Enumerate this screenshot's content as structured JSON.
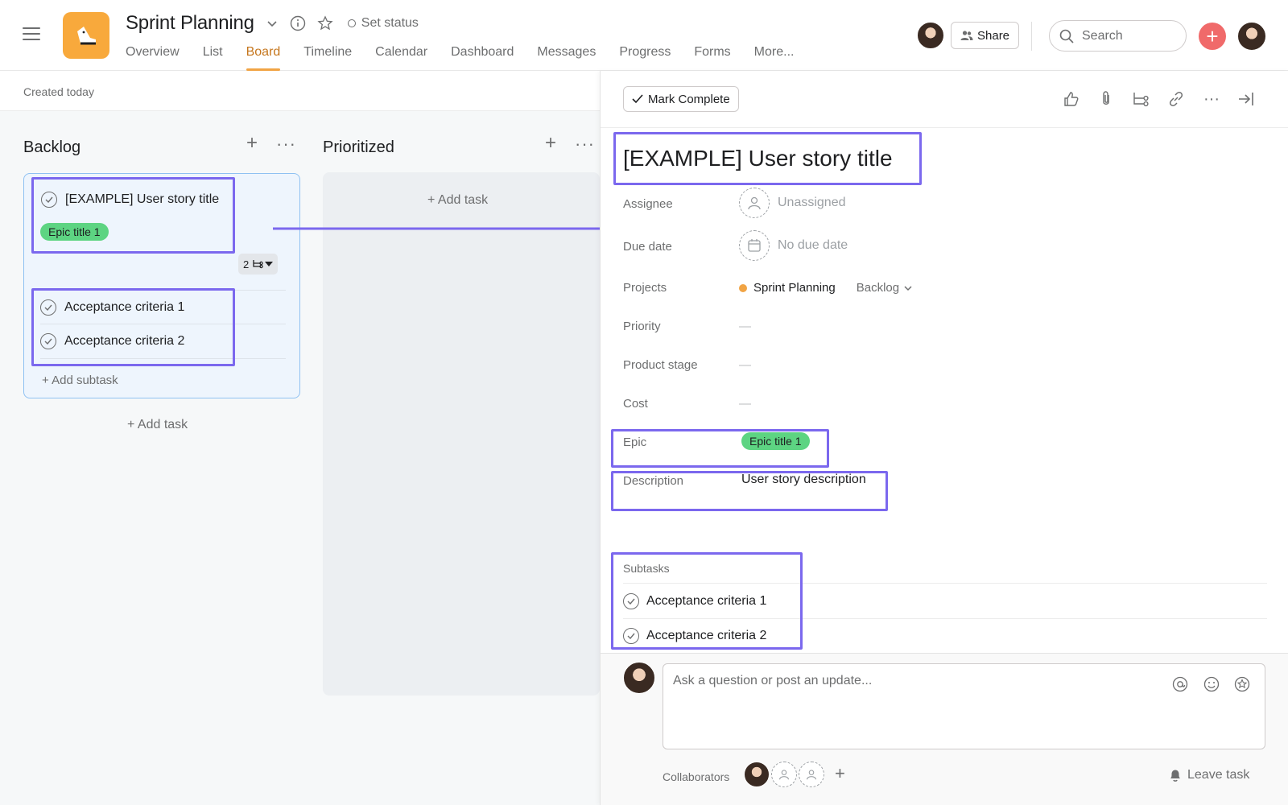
{
  "header": {
    "project_title": "Sprint Planning",
    "set_status": "Set status",
    "tabs": [
      {
        "label": "Overview"
      },
      {
        "label": "List"
      },
      {
        "label": "Board",
        "active": true
      },
      {
        "label": "Timeline"
      },
      {
        "label": "Calendar"
      },
      {
        "label": "Dashboard"
      },
      {
        "label": "Messages"
      },
      {
        "label": "Progress"
      },
      {
        "label": "Forms"
      },
      {
        "label": "More..."
      }
    ],
    "share_label": "Share",
    "search_placeholder": "Search",
    "add_glyph": "+"
  },
  "board": {
    "created": "Created today",
    "columns": [
      {
        "title": "Backlog",
        "add_task": "Add task"
      },
      {
        "title": "Prioritized",
        "add_task": "Add task"
      }
    ],
    "card": {
      "title": "[EXAMPLE] User story title",
      "epic": "Epic title 1",
      "subtask_count": "2",
      "subtasks": [
        "Acceptance criteria 1",
        "Acceptance criteria 2"
      ],
      "add_subtask": "Add subtask"
    }
  },
  "task_panel": {
    "mark_complete": "Mark Complete",
    "title": "[EXAMPLE] User story title",
    "fields": {
      "assignee_label": "Assignee",
      "assignee_value": "Unassigned",
      "due_label": "Due date",
      "due_value": "No due date",
      "projects_label": "Projects",
      "project_name": "Sprint Planning",
      "project_section": "Backlog",
      "priority_label": "Priority",
      "priority_value": "—",
      "stage_label": "Product stage",
      "stage_value": "—",
      "cost_label": "Cost",
      "cost_value": "—",
      "epic_label": "Epic",
      "epic_value": "Epic title 1",
      "description_label": "Description",
      "description_value": "User story description"
    },
    "subtasks_label": "Subtasks",
    "subtasks": [
      "Acceptance criteria 1",
      "Acceptance criteria 2"
    ],
    "comment_placeholder": "Ask a question or post an update...",
    "collaborators_label": "Collaborators",
    "leave_task": "Leave task"
  },
  "icons": [
    "menu-icon",
    "app-logo-icon",
    "chevron-down-icon",
    "info-icon",
    "star-icon",
    "people-icon",
    "search-icon",
    "check-icon",
    "thumbs-up-icon",
    "paperclip-icon",
    "subtask-icon",
    "link-icon",
    "more-icon",
    "close-panel-icon",
    "person-icon",
    "calendar-icon",
    "at-mention-icon",
    "emoji-icon",
    "praise-icon",
    "bell-icon"
  ],
  "colors": {
    "accent": "#f1a444",
    "active_tab": "#c5761d",
    "epic_pill": "#5dd482",
    "highlight": "#7b68ee",
    "add_button": "#f06a6a",
    "card_selected": "#eef5fd"
  }
}
